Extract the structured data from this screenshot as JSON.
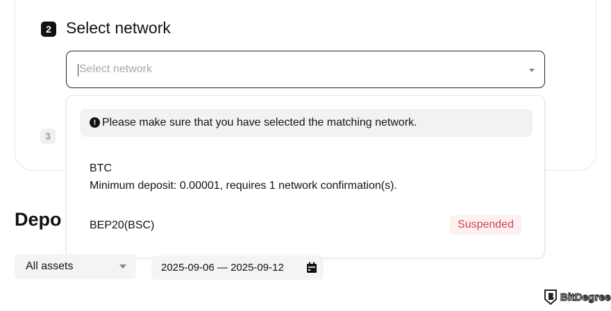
{
  "step2": {
    "number": "2",
    "title": "Select network"
  },
  "network_select": {
    "placeholder": "Select network",
    "icon": "chevron-down-icon"
  },
  "dropdown": {
    "notice_icon": "!",
    "notice": "Please make sure that you have selected the matching network.",
    "options": [
      {
        "name": "BTC",
        "description": "Minimum deposit: 0.00001, requires 1 network confirmation(s).",
        "status": ""
      },
      {
        "name": "BEP20(BSC)",
        "description": "",
        "status": "Suspended"
      }
    ]
  },
  "step3": {
    "number": "3"
  },
  "deposits": {
    "title": "Depo"
  },
  "filters": {
    "asset_label": "All assets",
    "date_range": "2025-09-06 — 2025-09-12"
  },
  "watermark": {
    "text": "BitDegree"
  },
  "colors": {
    "suspended_text": "#d9434f",
    "suspended_bg": "#fdf0f0",
    "notice_bg": "#f2f2f2",
    "filter_bg": "#f4f4f4"
  }
}
